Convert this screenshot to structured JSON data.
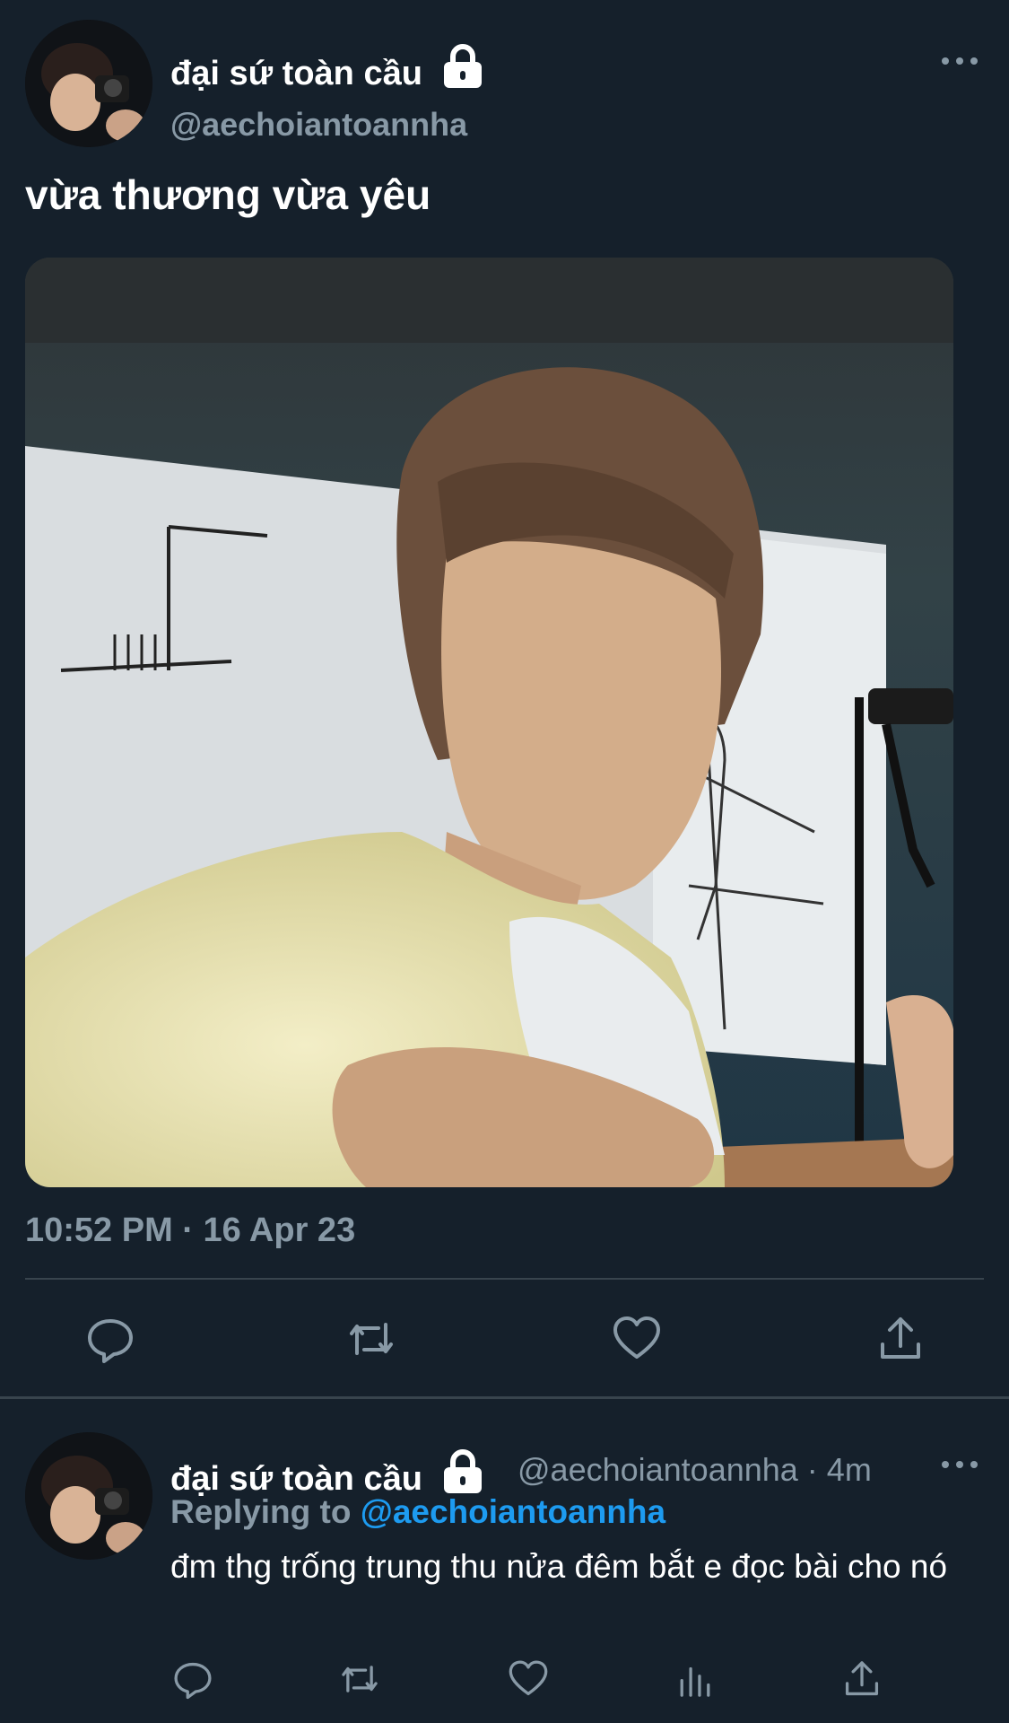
{
  "tweet": {
    "display_name": "đại sứ toàn cầu",
    "handle": "@aechoiantoannha",
    "text": "vừa thương vừa yêu",
    "timestamp": "10:52 PM · 16 Apr 23",
    "actions": [
      "reply-icon",
      "retweet-icon",
      "like-icon",
      "share-icon"
    ]
  },
  "reply": {
    "display_name": "đại sứ toàn cầu",
    "meta": "@aechoiantoannha · 4m",
    "replying_prefix": "Replying to",
    "replying_to": "@aechoiantoannha",
    "text": "đm thg trống trung thu nửa đêm bắt e đọc bài cho nó",
    "actions": [
      "reply-icon",
      "retweet-icon",
      "like-icon",
      "analytics-icon",
      "share-icon"
    ]
  },
  "colors": {
    "background": "#15202b",
    "secondary_text": "#8899a6",
    "link": "#1d9bf0",
    "divider": "#38444d"
  }
}
